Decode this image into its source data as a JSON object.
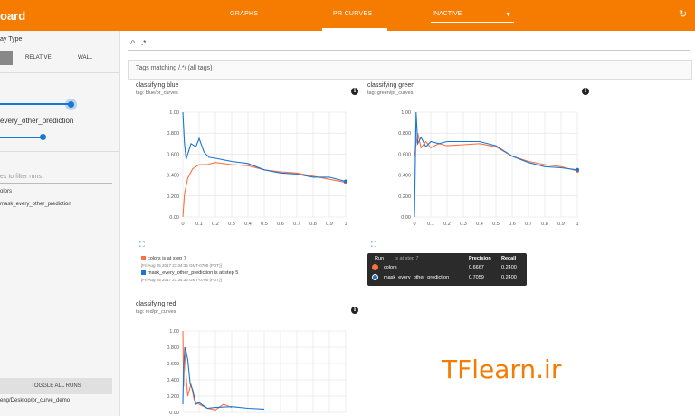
{
  "header": {
    "brand": "oard",
    "tabs": [
      {
        "label": "GRAPHS"
      },
      {
        "label": "PR CURVES"
      }
    ],
    "inactive_label": "INACTIVE",
    "colors": {
      "primary": "#f57c00",
      "blue": "#1976d2",
      "orange": "#ff7043"
    }
  },
  "sidebar": {
    "display_type_label": "ay Type",
    "relative_label": "RELATIVE",
    "wall_label": "WALL",
    "run_name": "every_other_prediction",
    "filter_placeholder": "ex to filter runs",
    "runs": [
      "olors",
      "mask_every_other_prediction"
    ],
    "toggle_all": "TOGGLE ALL RUNS",
    "path": "eng/Desktop/pr_curve_demo"
  },
  "search": {
    "value": ".*"
  },
  "tag_header": "Tags matching /.*/ (all tags)",
  "cards": [
    {
      "title": "classifying blue",
      "tag": "tag: blue/pr_curves",
      "legend": [
        {
          "text": "colors is at step 7",
          "sub": "[Fri Aug 25 2017 21:34:35 GMT-0700 (PDT)]"
        },
        {
          "text": "mask_every_other_prediction is at step 5",
          "sub": "[Fri Aug 25 2017 21:34:35 GMT-0700 (PDT)]"
        }
      ]
    },
    {
      "title": "classifying green",
      "tag": "tag: green/pr_curves"
    },
    {
      "title": "classifying red",
      "tag": "tag: red/pr_curves"
    }
  ],
  "tooltip": {
    "headers": [
      "Run",
      "Precision",
      "Recall"
    ],
    "rows": [
      {
        "run": "colors",
        "precision": "0.6667",
        "recall": "0.2400"
      },
      {
        "run": "mask_every_other_prediction",
        "precision": "0.7059",
        "recall": "0.2400"
      }
    ],
    "step_text": "is at step 7"
  },
  "watermark": "TFlearn.ir",
  "chart_data": [
    {
      "type": "line",
      "title": "classifying blue",
      "xticks": [
        "0",
        "0.1",
        "0.2",
        "0.3",
        "0.4",
        "0.5",
        "0.6",
        "0.7",
        "0.8",
        "0.9",
        "1"
      ],
      "yticks": [
        "0.00",
        "0.200",
        "0.400",
        "0.600",
        "0.800",
        "1.00"
      ],
      "xlim": [
        0,
        1
      ],
      "ylim": [
        0,
        1
      ],
      "series": [
        {
          "name": "colors",
          "color": "#ff7043",
          "points": [
            [
              0,
              0
            ],
            [
              0.01,
              0.22
            ],
            [
              0.03,
              0.37
            ],
            [
              0.06,
              0.46
            ],
            [
              0.1,
              0.5
            ],
            [
              0.15,
              0.5
            ],
            [
              0.2,
              0.52
            ],
            [
              0.3,
              0.5
            ],
            [
              0.4,
              0.49
            ],
            [
              0.5,
              0.45
            ],
            [
              0.6,
              0.43
            ],
            [
              0.7,
              0.42
            ],
            [
              0.8,
              0.39
            ],
            [
              0.9,
              0.36
            ],
            [
              1,
              0.33
            ]
          ]
        },
        {
          "name": "mask_every_other_prediction",
          "color": "#1976d2",
          "points": [
            [
              0,
              1
            ],
            [
              0.01,
              0.7
            ],
            [
              0.02,
              0.55
            ],
            [
              0.05,
              0.7
            ],
            [
              0.08,
              0.67
            ],
            [
              0.1,
              0.75
            ],
            [
              0.13,
              0.62
            ],
            [
              0.16,
              0.57
            ],
            [
              0.2,
              0.56
            ],
            [
              0.3,
              0.53
            ],
            [
              0.4,
              0.51
            ],
            [
              0.5,
              0.45
            ],
            [
              0.6,
              0.42
            ],
            [
              0.7,
              0.41
            ],
            [
              0.8,
              0.38
            ],
            [
              0.9,
              0.38
            ],
            [
              1,
              0.34
            ]
          ]
        }
      ]
    },
    {
      "type": "line",
      "title": "classifying green",
      "xticks": [
        "0",
        "0.1",
        "0.2",
        "0.3",
        "0.4",
        "0.5",
        "0.6",
        "0.7",
        "0.8",
        "0.9",
        "1"
      ],
      "yticks": [
        "0.00",
        "0.200",
        "0.400",
        "0.600",
        "0.800",
        "1.00"
      ],
      "xlim": [
        0,
        1
      ],
      "ylim": [
        0,
        1
      ],
      "series": [
        {
          "name": "colors",
          "color": "#ff7043",
          "points": [
            [
              0,
              0.58
            ],
            [
              0.02,
              0.8
            ],
            [
              0.04,
              0.66
            ],
            [
              0.07,
              0.72
            ],
            [
              0.1,
              0.66
            ],
            [
              0.15,
              0.7
            ],
            [
              0.2,
              0.68
            ],
            [
              0.3,
              0.69
            ],
            [
              0.4,
              0.7
            ],
            [
              0.5,
              0.67
            ],
            [
              0.6,
              0.58
            ],
            [
              0.7,
              0.53
            ],
            [
              0.8,
              0.5
            ],
            [
              0.9,
              0.48
            ],
            [
              1,
              0.44
            ]
          ]
        },
        {
          "name": "mask_every_other_prediction",
          "color": "#1976d2",
          "points": [
            [
              0,
              0
            ],
            [
              0.01,
              1
            ],
            [
              0.02,
              0.7
            ],
            [
              0.04,
              0.76
            ],
            [
              0.07,
              0.67
            ],
            [
              0.1,
              0.72
            ],
            [
              0.15,
              0.7
            ],
            [
              0.2,
              0.72
            ],
            [
              0.3,
              0.72
            ],
            [
              0.4,
              0.72
            ],
            [
              0.5,
              0.68
            ],
            [
              0.6,
              0.58
            ],
            [
              0.7,
              0.52
            ],
            [
              0.8,
              0.48
            ],
            [
              0.9,
              0.47
            ],
            [
              1,
              0.45
            ]
          ]
        }
      ]
    },
    {
      "type": "line",
      "title": "classifying red",
      "xticks": [],
      "yticks": [
        "1.00",
        "0.800",
        "0.600",
        "0.400",
        "0.200",
        "0.00"
      ],
      "xlim": [
        0,
        1
      ],
      "ylim": [
        0,
        1
      ],
      "series": [
        {
          "name": "colors",
          "color": "#ff7043",
          "points": [
            [
              0,
              1
            ],
            [
              0.005,
              0.32
            ],
            [
              0.01,
              0.8
            ],
            [
              0.02,
              0.45
            ],
            [
              0.03,
              0.2
            ],
            [
              0.05,
              0.35
            ],
            [
              0.07,
              0.15
            ],
            [
              0.1,
              0.1
            ],
            [
              0.15,
              0.05
            ],
            [
              0.2,
              0.03
            ],
            [
              0.25,
              0.1
            ],
            [
              0.3,
              0.06
            ]
          ]
        },
        {
          "name": "mask_every_other_prediction",
          "color": "#1976d2",
          "points": [
            [
              0,
              0.1
            ],
            [
              0.005,
              0.6
            ],
            [
              0.015,
              0.8
            ],
            [
              0.03,
              0.65
            ],
            [
              0.045,
              0.35
            ],
            [
              0.06,
              0.28
            ],
            [
              0.08,
              0.1
            ],
            [
              0.1,
              0.12
            ],
            [
              0.15,
              0.05
            ],
            [
              0.2,
              0.06
            ],
            [
              0.3,
              0.07
            ],
            [
              0.4,
              0.05
            ],
            [
              0.5,
              0.04
            ]
          ]
        }
      ]
    }
  ]
}
